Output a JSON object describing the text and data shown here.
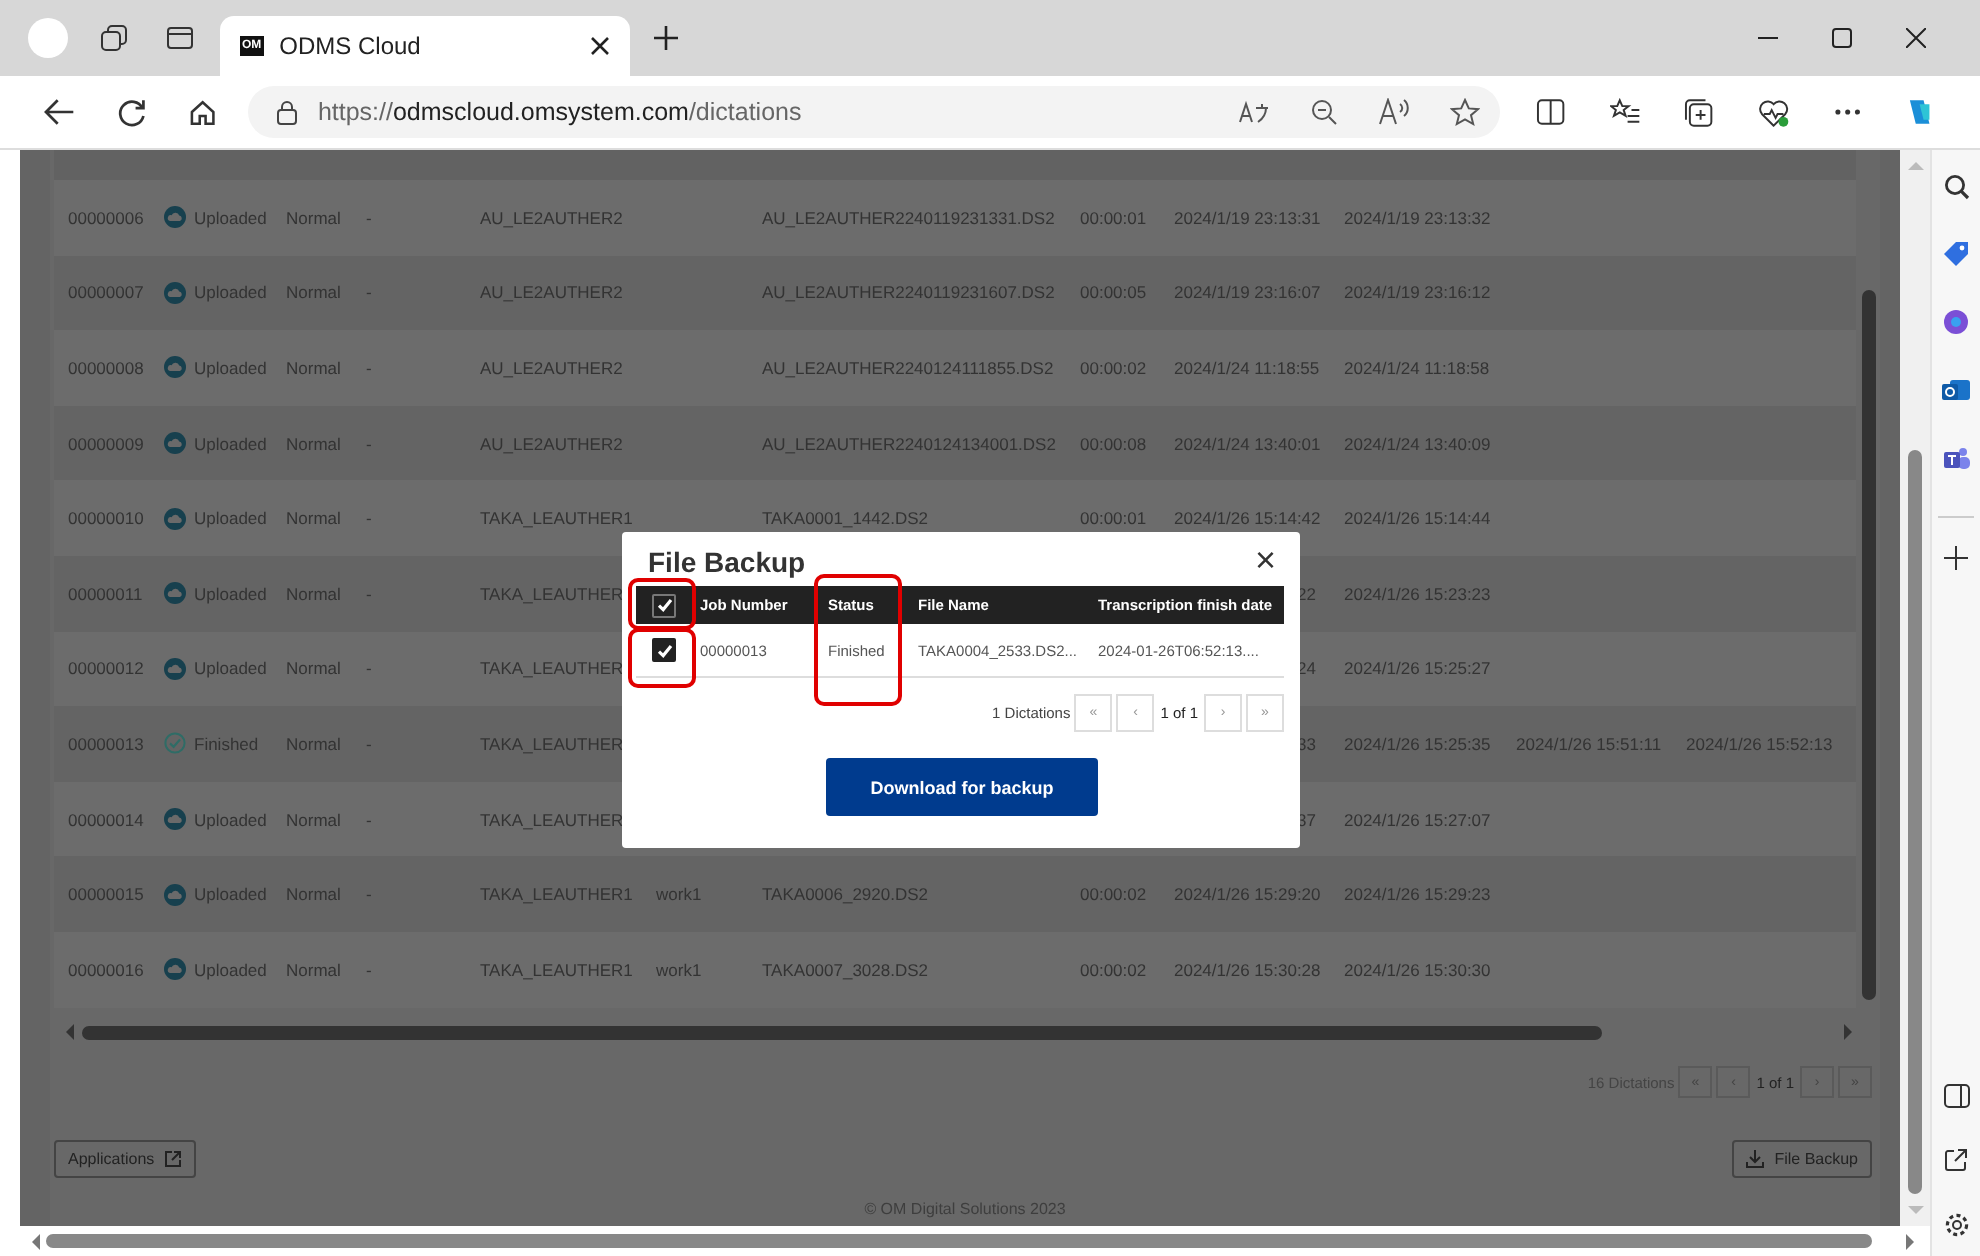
{
  "browser": {
    "tab_logo": "OM",
    "tab_title": "ODMS Cloud",
    "url_scheme": "https://",
    "url_host": "odmscloud.omsystem.com",
    "url_path": "/dictations"
  },
  "dictations": {
    "rows": [
      {
        "kind": "uploaded",
        "cells": [
          "00000006",
          "Uploaded",
          "Normal",
          "-",
          "AU_LE2AUTHER2",
          null,
          "AU_LE2AUTHER2240119231331.DS2",
          "00:00:01",
          "2024/1/19 23:13:31",
          "2024/1/19 23:13:32",
          null,
          null
        ]
      },
      {
        "kind": "uploaded",
        "cells": [
          "00000007",
          "Uploaded",
          "Normal",
          "-",
          "AU_LE2AUTHER2",
          null,
          "AU_LE2AUTHER2240119231607.DS2",
          "00:00:05",
          "2024/1/19 23:16:07",
          "2024/1/19 23:16:12",
          null,
          null
        ]
      },
      {
        "kind": "uploaded",
        "cells": [
          "00000008",
          "Uploaded",
          "Normal",
          "-",
          "AU_LE2AUTHER2",
          null,
          "AU_LE2AUTHER2240124111855.DS2",
          "00:00:02",
          "2024/1/24 11:18:55",
          "2024/1/24 11:18:58",
          null,
          null
        ]
      },
      {
        "kind": "uploaded",
        "cells": [
          "00000009",
          "Uploaded",
          "Normal",
          "-",
          "AU_LE2AUTHER2",
          null,
          "AU_LE2AUTHER2240124134001.DS2",
          "00:00:08",
          "2024/1/24 13:40:01",
          "2024/1/24 13:40:09",
          null,
          null
        ]
      },
      {
        "kind": "uploaded",
        "cells": [
          "00000010",
          "Uploaded",
          "Normal",
          "-",
          "TAKA_LEAUTHER1",
          null,
          "TAKA0001_1442.DS2",
          "00:00:01",
          "2024/1/26 15:14:42",
          "2024/1/26 15:14:44",
          null,
          null
        ]
      },
      {
        "kind": "uploaded",
        "cells": [
          "00000011",
          "Uploaded",
          "Normal",
          "-",
          "TAKA_LEAUTHER",
          null,
          null,
          null,
          "22",
          "2024/1/26 15:23:23",
          null,
          null
        ]
      },
      {
        "kind": "uploaded",
        "cells": [
          "00000012",
          "Uploaded",
          "Normal",
          "-",
          "TAKA_LEAUTHER",
          null,
          null,
          null,
          "24",
          "2024/1/26 15:25:27",
          null,
          null
        ]
      },
      {
        "kind": "finished",
        "cells": [
          "00000013",
          "Finished",
          "Normal",
          "-",
          "TAKA_LEAUTHER",
          null,
          null,
          null,
          "33",
          "2024/1/26 15:25:35",
          "2024/1/26 15:51:11",
          "2024/1/26 15:52:13"
        ]
      },
      {
        "kind": "uploaded",
        "cells": [
          "00000014",
          "Uploaded",
          "Normal",
          "-",
          "TAKA_LEAUTHER",
          null,
          null,
          null,
          "37",
          "2024/1/26 15:27:07",
          null,
          null
        ]
      },
      {
        "kind": "uploaded",
        "cells": [
          "00000015",
          "Uploaded",
          "Normal",
          "-",
          "TAKA_LEAUTHER1",
          "work1",
          "TAKA0006_2920.DS2",
          "00:00:02",
          "2024/1/26 15:29:20",
          "2024/1/26 15:29:23",
          null,
          null
        ]
      },
      {
        "kind": "uploaded",
        "cells": [
          "00000016",
          "Uploaded",
          "Normal",
          "-",
          "TAKA_LEAUTHER1",
          "work1",
          "TAKA0007_3028.DS2",
          "00:00:02",
          "2024/1/26 15:30:28",
          "2024/1/26 15:30:30",
          null,
          null
        ]
      }
    ],
    "count": "16 Dictations",
    "page": "1 of 1",
    "pager": [
      "«",
      "‹",
      "›",
      "»"
    ]
  },
  "actions": {
    "applications": "Applications",
    "file_backup": "File Backup"
  },
  "footer": "© OM Digital Solutions 2023",
  "backup": {
    "title": "File Backup",
    "close": "×",
    "select_all_checked": true,
    "columns": [
      "Job Number",
      "Status",
      "File Name",
      "Transcription finish date"
    ],
    "rows": [
      {
        "checked": true,
        "cells": [
          "00000013",
          "Finished",
          "TAKA0004_2533.DS2...",
          "2024-01-26T06:52:13...."
        ]
      }
    ],
    "count": "1 Dictations",
    "page": "1 of 1",
    "pager": [
      "«",
      "‹",
      "›",
      "»"
    ],
    "download": "Download for backup"
  }
}
